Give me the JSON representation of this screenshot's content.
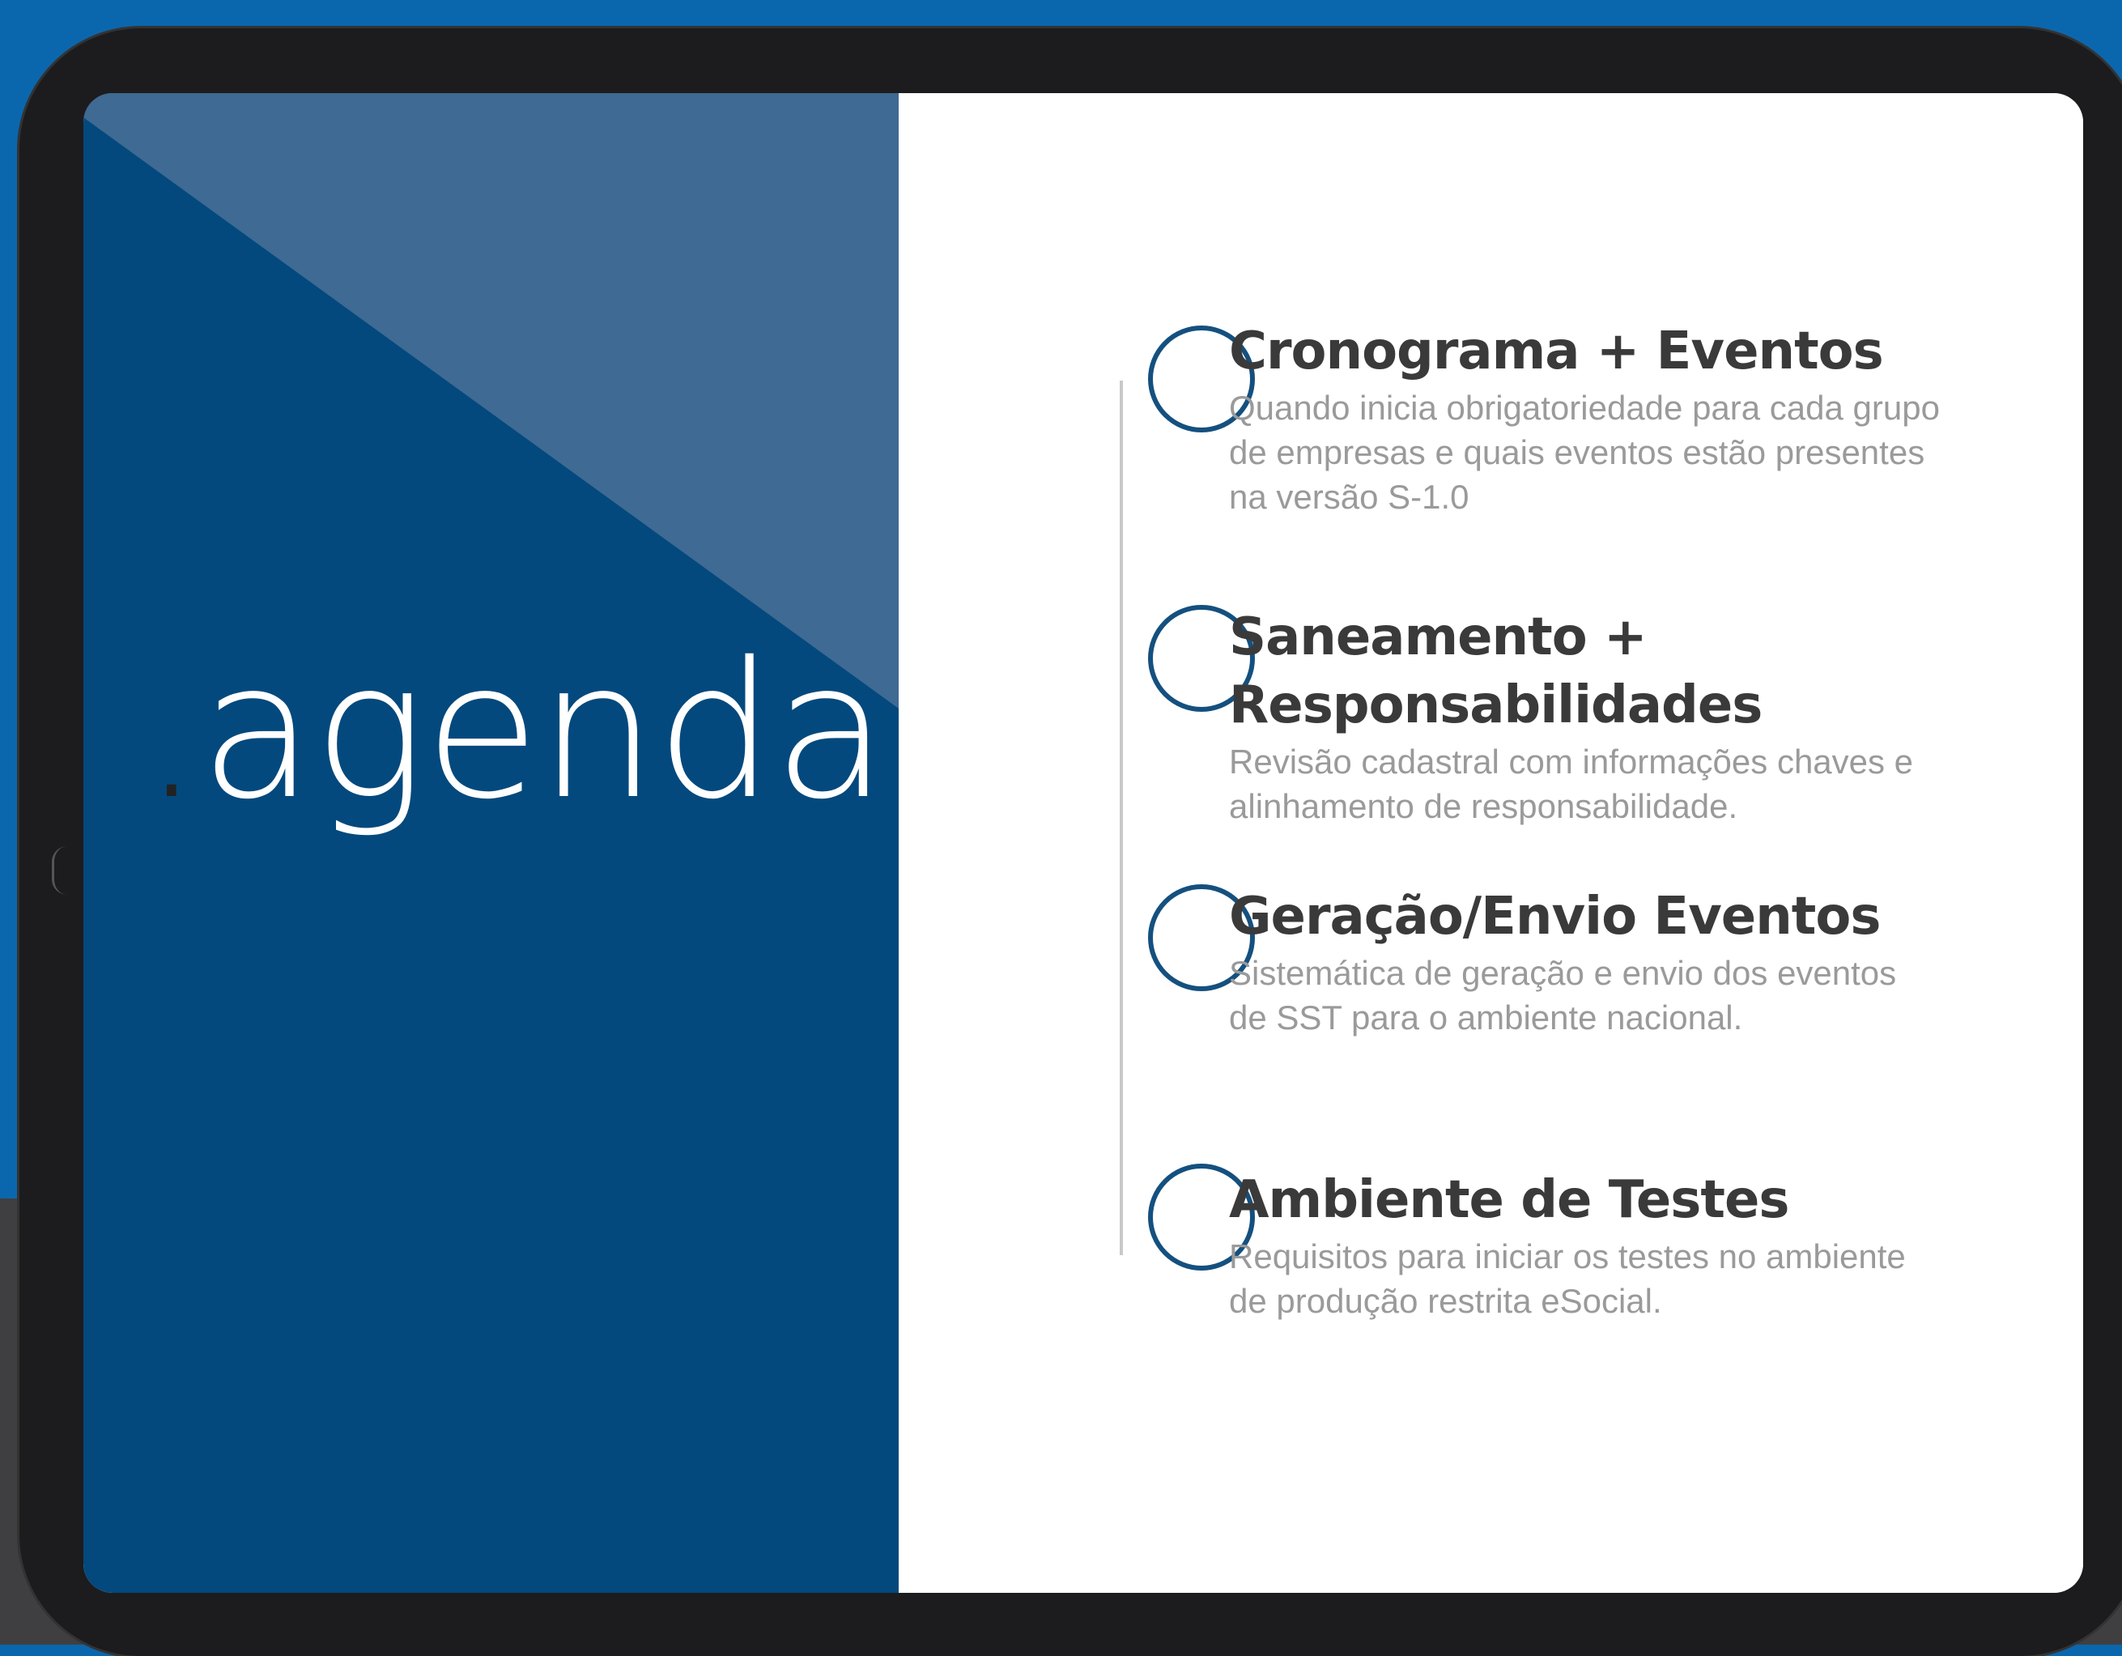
{
  "slide": {
    "title": "agenda",
    "title_prefix": ".",
    "colors": {
      "background": "#0b67ad",
      "left_panel": "#03497d",
      "left_triangle": "#3e6a93",
      "accent_circle": "#14507f",
      "title_text": "#3a3a3a",
      "description_text": "#9a9a9a"
    },
    "items": [
      {
        "title": "Cronograma + Eventos",
        "description": "Quando inicia obrigatoriedade para cada grupo de empresas e quais eventos estão presentes na versão S-1.0"
      },
      {
        "title": "Saneamento + Responsabilidades",
        "description": "Revisão cadastral com informações chaves e alinhamento de responsabilidade."
      },
      {
        "title": "Geração/Envio Eventos",
        "description": "Sistemática de geração e envio dos eventos de SST para o ambiente nacional."
      },
      {
        "title": "Ambiente de Testes",
        "description": "Requisitos para iniciar os testes no ambiente de produção restrita eSocial."
      }
    ]
  }
}
